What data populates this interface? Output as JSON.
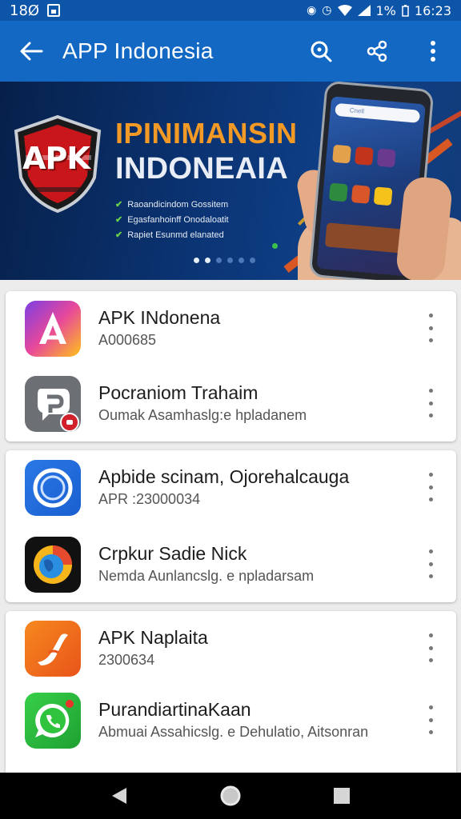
{
  "status_bar": {
    "time_left": "18Ø",
    "battery": "1%",
    "time": "16:23"
  },
  "app_bar": {
    "title": "APP Indonesia",
    "icons": [
      "back-arrow-icon",
      "search-icon",
      "share-icon",
      "more-vert-icon"
    ]
  },
  "banner": {
    "logo_text": "APK",
    "headline_line1": "IPINIMANSIN",
    "headline_line2": "INDONEAIA",
    "bullets": [
      "Raoandicindom Gossitem",
      "Egasfanhoinff Onodaloatit",
      "Rapiet Esunmd elanated"
    ],
    "carousel_pages": 6,
    "carousel_active": 1,
    "phone_search_text": "Cnell"
  },
  "apps": [
    {
      "title": "APK INdonena",
      "subtitle": "A000685",
      "icon": "apk-a-icon",
      "colors": [
        "#7b3fe4",
        "#f44a8a",
        "#ffc21a",
        "#1fb6f0"
      ]
    },
    {
      "title": "Pocraniom Trahaim",
      "subtitle": "Oumak Asamhaslg:e hpladanem",
      "icon": "chat-bubble-icon",
      "colors": [
        "#6c6f74",
        "#9aa0a6"
      ]
    },
    {
      "title": "Apbide scinam, Ojorehalcauga",
      "subtitle": "APR :23000034",
      "icon": "blue-ring-icon",
      "colors": [
        "#1f6fe0",
        "#4a9cf5"
      ]
    },
    {
      "title": "Crpkur Sadie Nick",
      "subtitle": "Nemda Aunlancslg. e npladarsam",
      "icon": "browser-globe-icon",
      "colors": [
        "#1a1a1a",
        "#e64a2e",
        "#f6b51a",
        "#2a8fe0"
      ]
    },
    {
      "title": "APK Naplaita",
      "subtitle": "2300634",
      "icon": "orange-swoosh-icon",
      "colors": [
        "#f47a1a",
        "#e8541a"
      ]
    },
    {
      "title": "PurandiartinaKaan",
      "subtitle": "Abmuai Assahicslg. e Dehulatio, Aitsonran",
      "icon": "whatsapp-icon",
      "colors": [
        "#2fc33e",
        "#1ea032"
      ]
    }
  ],
  "nav_bar": {
    "icons": [
      "back-triangle-icon",
      "home-circle-icon",
      "recents-square-icon"
    ]
  },
  "colors": {
    "app_bar": "#1368c4",
    "status_bar": "#0c55a8",
    "background": "#ececec"
  }
}
